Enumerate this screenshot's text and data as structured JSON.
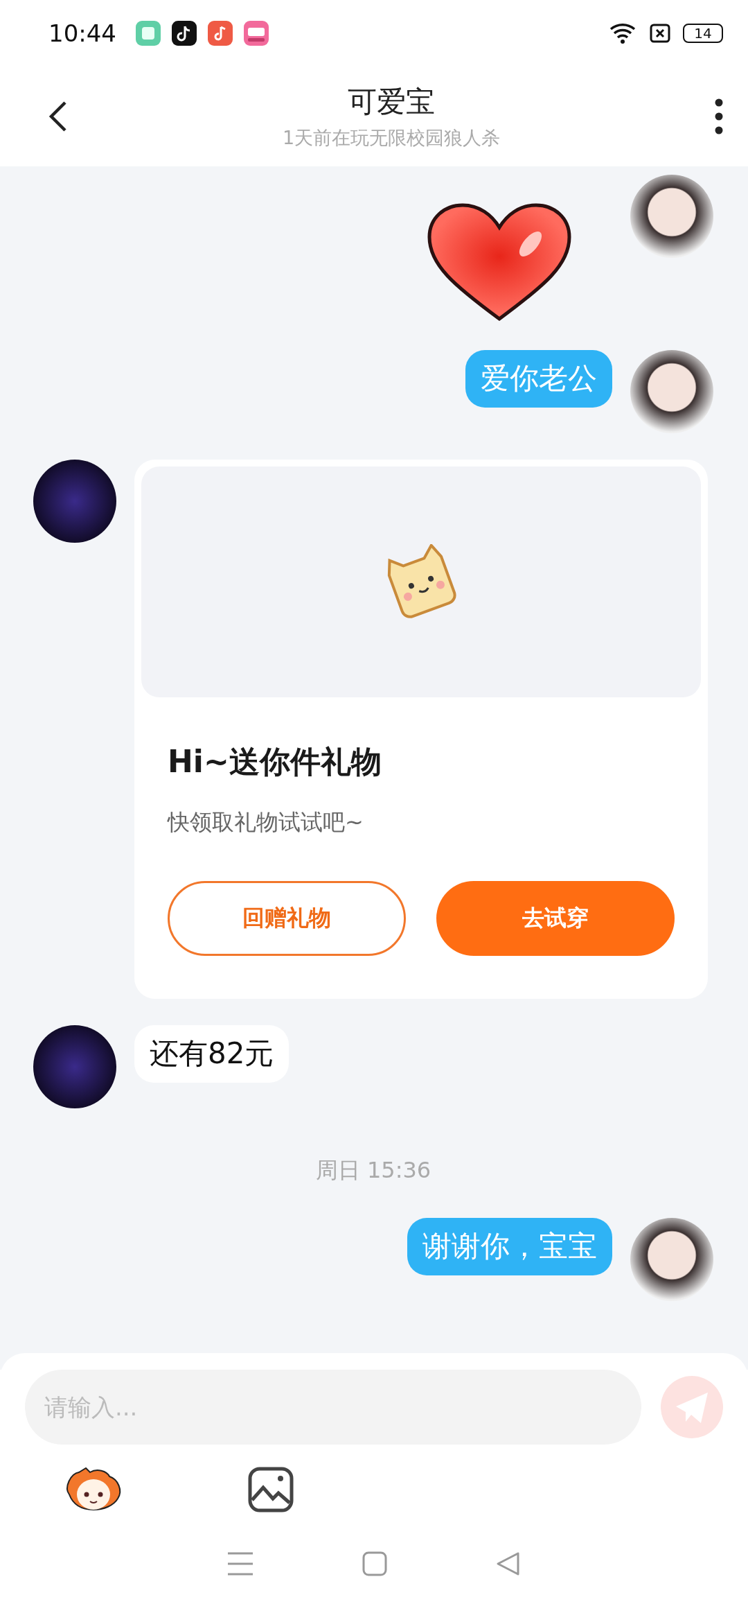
{
  "status_bar": {
    "time": "10:44",
    "battery": "14"
  },
  "header": {
    "title": "可爱宝",
    "subtitle": "1天前在玩无限校园狼人杀"
  },
  "messages": [
    {
      "kind": "sticker",
      "outgoing": true
    },
    {
      "kind": "text",
      "outgoing": true,
      "text": "爱你老公"
    },
    {
      "kind": "gift_card",
      "outgoing": false,
      "title": "Hi~送你件礼物",
      "subtitle": "快领取礼物试试吧~",
      "buttons": [
        {
          "kind": "outline",
          "label": "回赠礼物"
        },
        {
          "kind": "filled",
          "label": "去试穿"
        }
      ]
    },
    {
      "kind": "text",
      "outgoing": false,
      "text": "还有82元"
    },
    {
      "kind": "timestamp",
      "text": "周日 15:36"
    },
    {
      "kind": "text",
      "outgoing": true,
      "text": "谢谢你，宝宝"
    }
  ],
  "composer": {
    "placeholder": "请输入..."
  }
}
